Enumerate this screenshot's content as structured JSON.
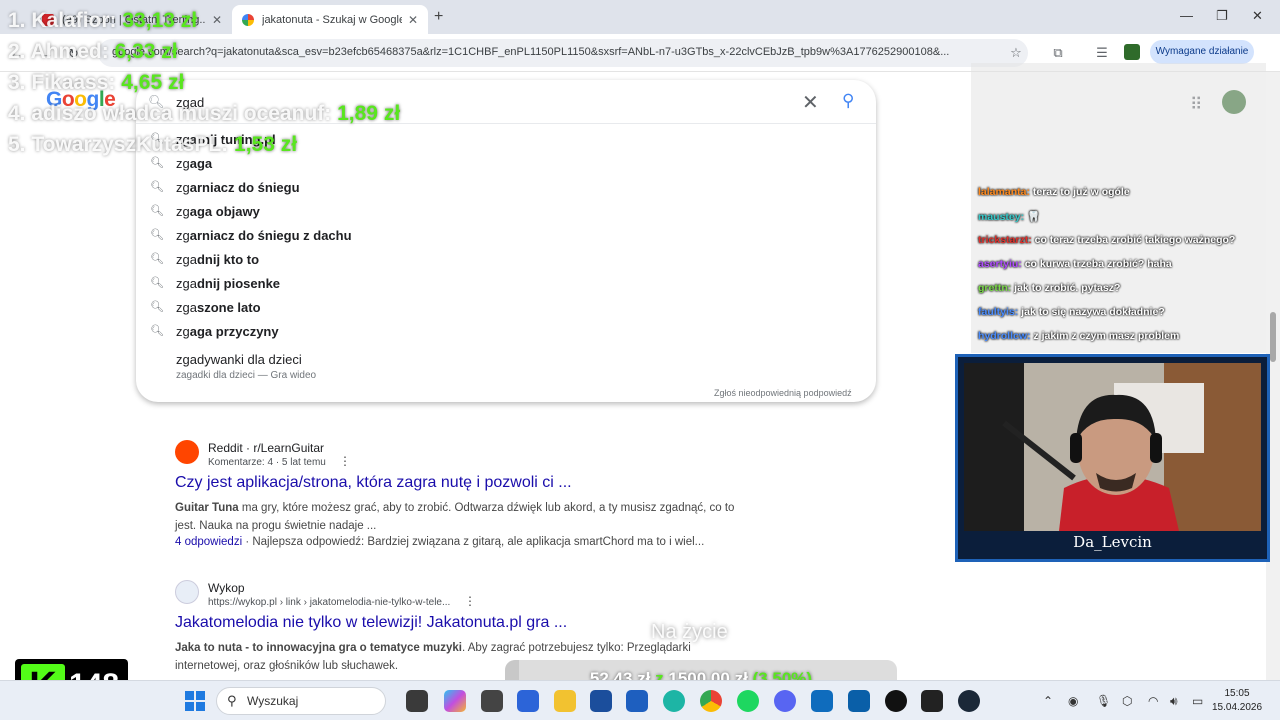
{
  "browser": {
    "tabs": [
      {
        "title": "(99) Szpon | Ostatni Trening...",
        "active": false
      },
      {
        "title": "jakatonuta - Szukaj w Google",
        "active": true
      }
    ],
    "url": "google.com/search?q=jakatonuta&sca_esv=b23efcb65468375a&rlz=1C1CHBF_enPL1150PL1150&sxsrf=ANbL-n7-u3GTbs_x-22clvCEbJzB_tpb9w%3A1776252900108&...",
    "required_action_label": "Wymagane działanie"
  },
  "google": {
    "logo_letters": [
      {
        "char": "G",
        "color": "#4285f4"
      },
      {
        "char": "o",
        "color": "#ea4335"
      },
      {
        "char": "o",
        "color": "#fbbc05"
      },
      {
        "char": "g",
        "color": "#4285f4"
      },
      {
        "char": "l",
        "color": "#34a853"
      },
      {
        "char": "e",
        "color": "#ea4335"
      }
    ],
    "query": "zgad",
    "suggestions": [
      {
        "prefix": "zg",
        "rest": "arnij tuning.pl"
      },
      {
        "prefix": "zg",
        "rest": "aga"
      },
      {
        "prefix": "zg",
        "rest": "arniacz do śniegu"
      },
      {
        "prefix": "zg",
        "rest": "aga objawy"
      },
      {
        "prefix": "zg",
        "rest": "arniacz do śniegu z dachu"
      },
      {
        "prefix": "zga",
        "rest": "dnij kto to"
      },
      {
        "prefix": "zga",
        "rest": "dnij piosenke"
      },
      {
        "prefix": "zga",
        "rest": "szone lato"
      },
      {
        "prefix": "zg",
        "rest": "aga przyczyny"
      }
    ],
    "rich_suggestion": {
      "title": "zgadywanki dla dzieci",
      "subtitle": "zagadki dla dzieci — Gra wideo"
    },
    "report_label": "Zgłoś nieodpowiednią podpowiedź"
  },
  "results": [
    {
      "source": "Reddit · r/LearnGuitar",
      "meta": "Komentarze: 4 · 5 lat temu",
      "title": "Czy jest aplikacja/strona, która zagra nutę i pozwoli ci ...",
      "snippet_bold": "Guitar Tuna",
      "snippet": " ma gry, które możesz grać, aby to zrobić. Odtwarza dźwięk lub akord, a ty musisz zgadnąć, co to jest. Nauka na progu świetnie nadaje ...",
      "answers_link": "4 odpowiedzi",
      "answers_text": " · Najlepsza odpowiedź: Bardziej związana z gitarą, ale aplikacja smartChord ma to i wiel..."
    },
    {
      "source": "Wykop",
      "meta": "https://wykop.pl › link › jakatomelodia-nie-tylko-w-tele...",
      "title": "Jakatomelodia nie tylko w telewizji! Jakatonuta.pl gra ...",
      "snippet_bold": "Jaka to nuta - to innowacyjna gra o tematyce muzyki",
      "snippet": ". Aby zagrać potrzebujesz tylko: Przeglądarki internetowej, oraz głośników lub słuchawek."
    }
  ],
  "overlay": {
    "leaderboard": [
      {
        "name": "1. Kalafior:",
        "amount": "33,13 zł"
      },
      {
        "name": "2. Ahmed:",
        "amount": "6,33 zł"
      },
      {
        "name": "3. Fikaass:",
        "amount": "4,65 zł"
      },
      {
        "name": "4. adiszo władca muszi oceanuf:",
        "amount": "1,89 zł"
      },
      {
        "name": "5. TowarzyszKutasPL:",
        "amount": "1,53 zł"
      }
    ],
    "chat": [
      {
        "user": "lalamanta:",
        "text": " teraz to już w ogóle",
        "color": "#ff8a1e"
      },
      {
        "user": "maustey:",
        "text": " 🦷",
        "color": "#35c9c9"
      },
      {
        "user": "trickstarzt:",
        "text": " co teraz trzeba zrobić takiego ważnego?",
        "color": "#e0302c"
      },
      {
        "user": "asertyiu:",
        "text": " co kurwa trzeba zrobić? haha",
        "color": "#b04cff"
      },
      {
        "user": "grettn:",
        "text": " jak to zrobić. pytasz?",
        "color": "#7bd94a"
      },
      {
        "user": "faultyis:",
        "text": " jak to się nazywa dokładnie?",
        "color": "#4a8dff"
      },
      {
        "user": "hydrollcw:",
        "text": " z jakim z czym masz problem",
        "color": "#4a8dff"
      }
    ],
    "streamer_name": "Da_Levcin",
    "kick_viewers": "148",
    "subtitle": "Na życie",
    "goal": {
      "current": "52,43 zł",
      "sep": "z",
      "target": "1500,00 zł",
      "percent_label": "(3,50%)",
      "progress": 0.035
    }
  },
  "taskbar": {
    "search_label": "Wyszukaj",
    "time": "15:05",
    "date": "15.04.2026"
  }
}
